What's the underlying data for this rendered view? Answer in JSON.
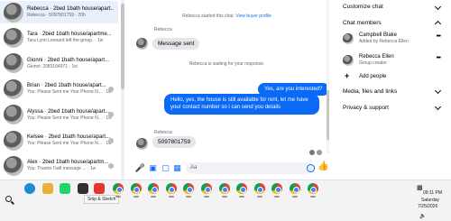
{
  "chat_list": {
    "items": [
      {
        "name": "Rebecca · 2bed 1bath house/apart...",
        "preview": "Rebecca · 5097801759 · 20h",
        "active": true
      },
      {
        "name": "Tara · 2bed 1bath house/apartme...",
        "preview": "Tara Lynn Leonard left the group. · 1w",
        "active": false
      },
      {
        "name": "Gionni · 2bed 1bath house/apart...",
        "preview": "Gionni: 2083104971 · 1w",
        "active": false
      },
      {
        "name": "Brian · 2bed 1bath house/apart...",
        "preview": "You: Please Sent me Your Phone N... · 1w",
        "active": false
      },
      {
        "name": "Alyssa · 2bed 1bath house/apart...",
        "preview": "You: Please Sent me Your Phone N... · 1w",
        "active": false
      },
      {
        "name": "Kelsee · 2bed 1bath house/apart...",
        "preview": "You: Please Sent me Your Phone N... · 1w",
        "active": false
      },
      {
        "name": "Alex · 2bed 1bath house/apartm...",
        "preview": "You: Thanks I'will message ... · 1w",
        "active": false
      }
    ]
  },
  "conversation": {
    "system_started": "Rebecca started this chat.",
    "system_link": "View buyer profile",
    "sender_top": "Rebecca",
    "msg_sent": "Message sent",
    "system_waiting": "Rebecca is waiting for your response.",
    "out_1": "Yes, are you interested?",
    "out_2": "Hello, yes, the house is still available for rent, let me have your contact number so i can send you details",
    "sender_bottom": "Rebecca",
    "in_number": "5097801759",
    "input_placeholder": "Aa"
  },
  "info_panel": {
    "customize_chat": "Customize chat",
    "chat_members": "Chat members",
    "members": [
      {
        "name": "Campbell Blake",
        "sub": "Added by Rebecca Ellen"
      },
      {
        "name": "Rebecca Ellen",
        "sub": "Group creator"
      }
    ],
    "add_people": "Add people",
    "media": "Media, files and links",
    "privacy": "Privacy & support"
  },
  "taskbar": {
    "tooltip": "Snip & Sketch",
    "time": "09:11 PM",
    "day": "Saturday",
    "date": "7/25/2026",
    "chrome_count": 12
  },
  "colors": {
    "accent": "#0866ff",
    "bubble_out": "#0a69f5",
    "bubble_in": "#e4e6eb",
    "active_row": "#e7f0fb"
  }
}
